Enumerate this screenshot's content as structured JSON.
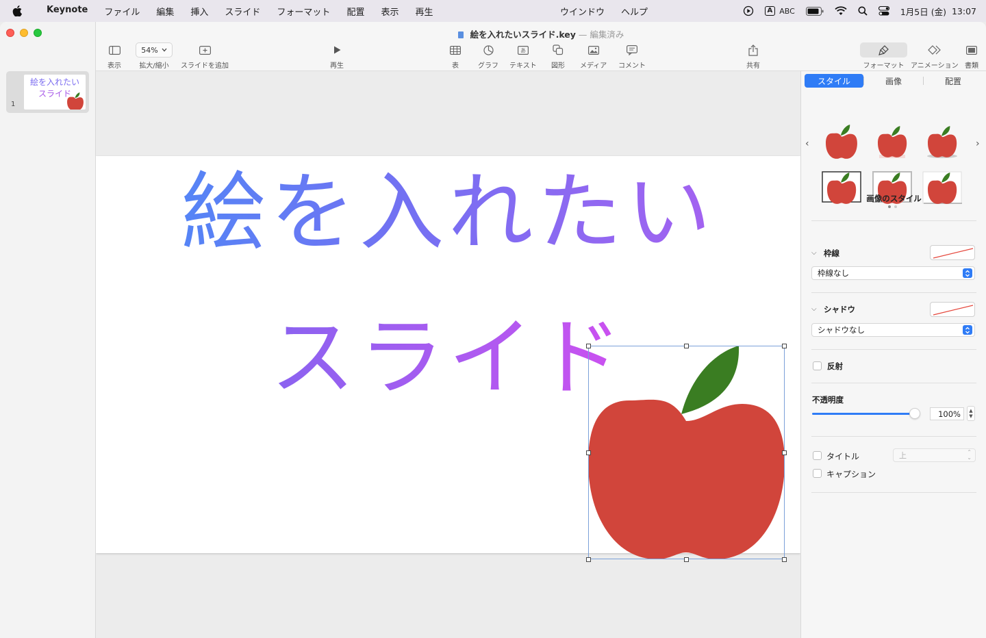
{
  "menubar": {
    "app_name": "Keynote",
    "items": [
      "ファイル",
      "編集",
      "挿入",
      "スライド",
      "フォーマット",
      "配置",
      "表示",
      "再生"
    ],
    "center_items": [
      "ウインドウ",
      "ヘルプ"
    ],
    "input_mode": "A",
    "input_label": "ABC",
    "date": "1月5日 (金)",
    "time": "13:07"
  },
  "window": {
    "doc_name": "絵を入れたいスライド.key",
    "doc_status": "— 編集済み"
  },
  "toolbar": {
    "view_label": "表示",
    "zoom_value": "54%",
    "zoom_label": "拡大/縮小",
    "add_slide_label": "スライドを追加",
    "play_label": "再生",
    "table_label": "表",
    "chart_label": "グラフ",
    "text_label": "テキスト",
    "shape_label": "図形",
    "media_label": "メディア",
    "comment_label": "コメント",
    "share_label": "共有",
    "format_label": "フォーマット",
    "animate_label": "アニメーション",
    "document_label": "書類"
  },
  "navigator": {
    "slide_number": "1",
    "thumb_line1": "絵を入れたい",
    "thumb_line2": "スライド"
  },
  "slide": {
    "line1": "絵を入れたい",
    "line2": "スライド"
  },
  "inspector": {
    "tabs": [
      "スタイル",
      "画像",
      "配置"
    ],
    "active_tab": "スタイル",
    "image_styles_label": "画像のスタイル",
    "border_label": "枠線",
    "border_value": "枠線なし",
    "shadow_label": "シャドウ",
    "shadow_value": "シャドウなし",
    "reflection_label": "反射",
    "opacity_label": "不透明度",
    "opacity_value": "100%",
    "opacity_fraction": 1.0,
    "title_label": "タイトル",
    "title_position": "上",
    "caption_label": "キャプション"
  },
  "colors": {
    "accent": "#2f7cf6",
    "apple_red": "#d1453b",
    "leaf_green": "#3a7d22"
  }
}
